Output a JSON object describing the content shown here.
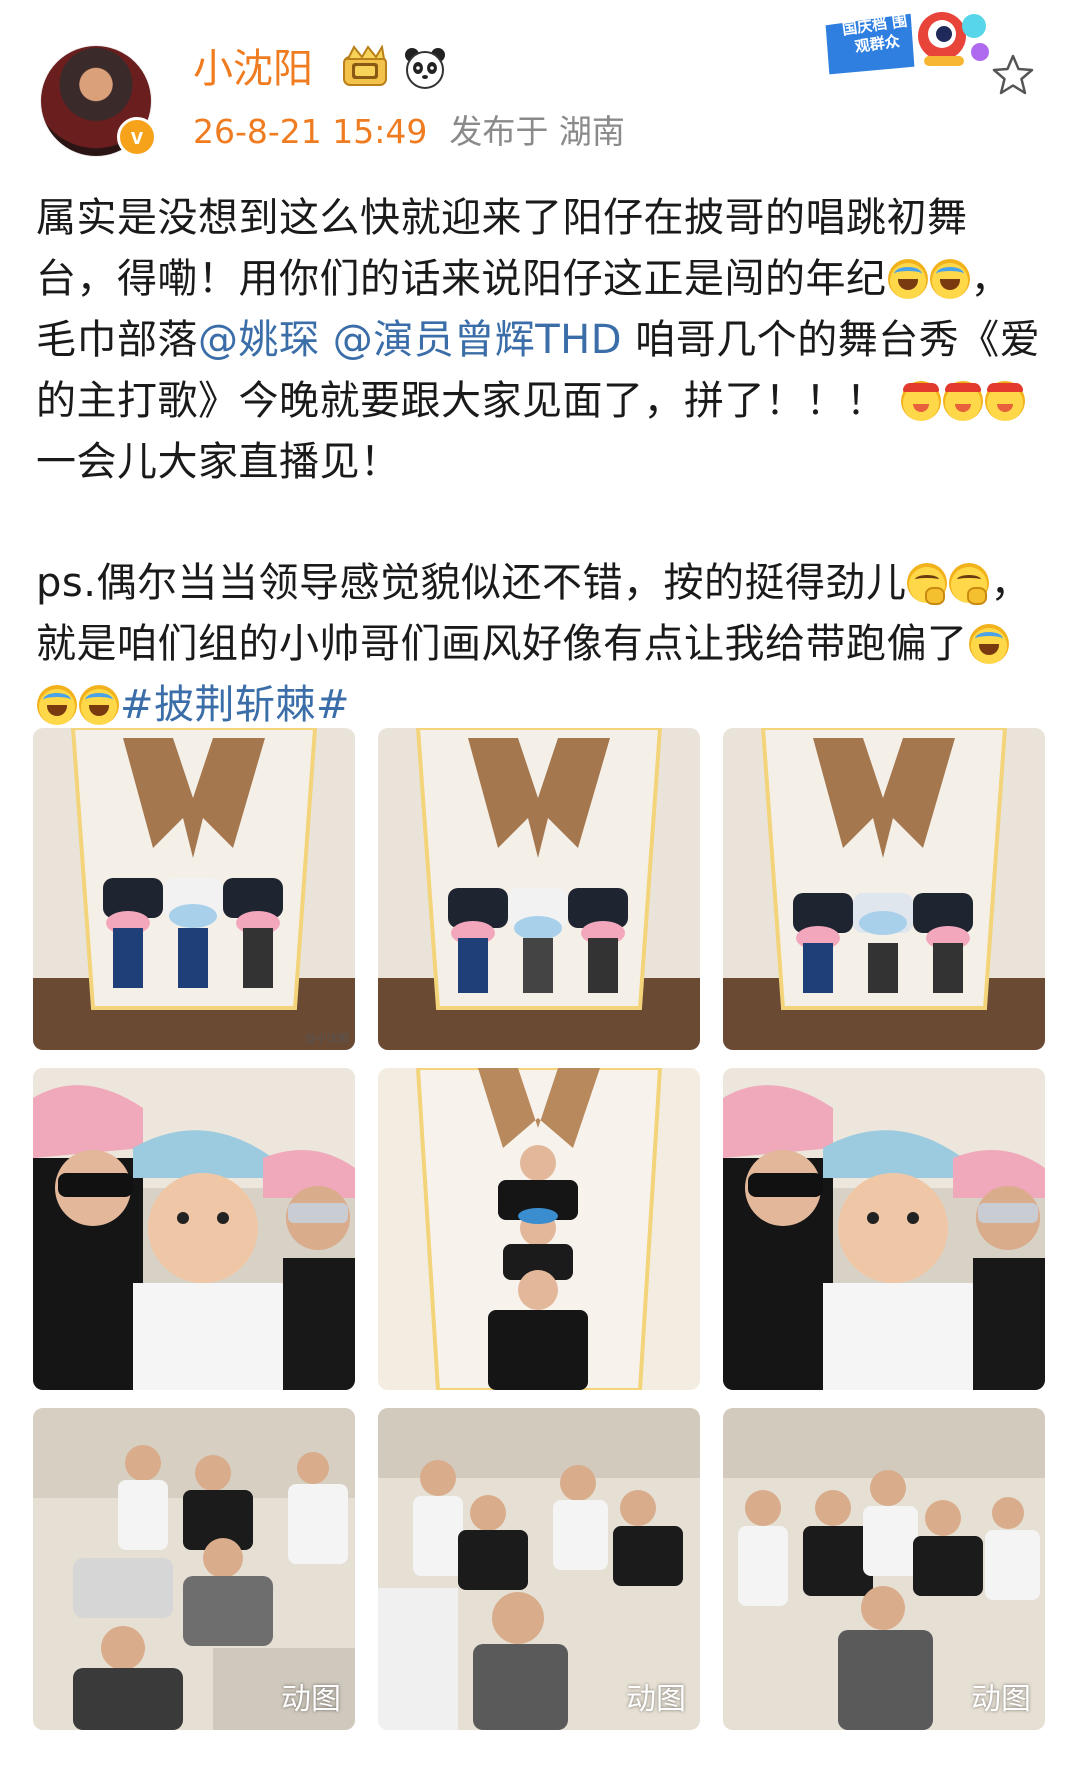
{
  "header": {
    "username": "小沈阳",
    "time": "26-8-21 15:49",
    "location": "发布于 湖南",
    "campaign_text": "国庆档 围观群众",
    "verified_mark": "v"
  },
  "body": {
    "p1_a": "属实是没想到这么快就迎来了阳仔在披哥的唱跳初舞台，得嘞！用你们的话来说阳仔这正是闯的年纪",
    "p1_b": "，毛巾部落",
    "mention_1": "@姚琛",
    "mention_2": "@演员曾辉THD",
    "p1_c": "咱哥几个的舞台秀《爱的主打歌》今晚就要跟大家见面了，拼了！！！",
    "p1_d": "一会儿大家直播见！",
    "p2_a": "ps.偶尔当当领导感觉貌似还不错，按的挺得劲儿",
    "p2_b": "，就是咱们组的小帅哥们画风好像有点让我给带跑偏了",
    "hashtag": "#披荆斩棘#"
  },
  "grid": {
    "watermark": "@小沈阳",
    "gif_label": "动图",
    "images": [
      {
        "id": 1,
        "scene": "wall-pose",
        "is_gif": false
      },
      {
        "id": 2,
        "scene": "wall-pose",
        "is_gif": false
      },
      {
        "id": 3,
        "scene": "wall-pose",
        "is_gif": false
      },
      {
        "id": 4,
        "scene": "selfie",
        "is_gif": false
      },
      {
        "id": 5,
        "scene": "stack-pose",
        "is_gif": false
      },
      {
        "id": 6,
        "scene": "selfie",
        "is_gif": false
      },
      {
        "id": 7,
        "scene": "massage",
        "is_gif": true
      },
      {
        "id": 8,
        "scene": "massage",
        "is_gif": true
      },
      {
        "id": 9,
        "scene": "massage",
        "is_gif": true
      }
    ]
  },
  "colors": {
    "username": "#f07c21",
    "link": "#3b6ea8",
    "meta": "#8a8a8a"
  }
}
